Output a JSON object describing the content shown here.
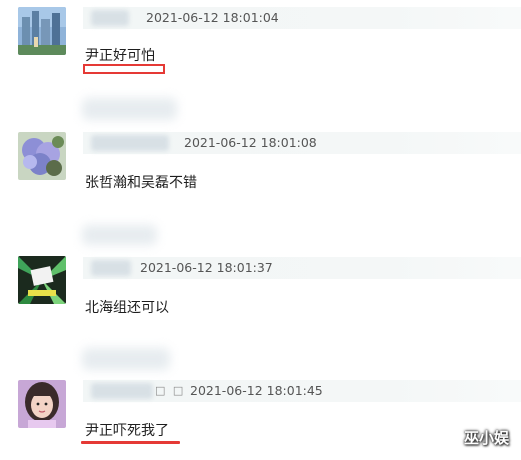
{
  "comments": [
    {
      "avatar": "anime-city-avatar-icon",
      "timestamp": "2021-06-12 18:01:04",
      "text": "尹正好可怕",
      "highlight": "box"
    },
    {
      "avatar": "hydrangea-flower-avatar-icon",
      "timestamp": "2021-06-12 18:01:08",
      "text": "张哲瀚和吴磊不错",
      "highlight": "none"
    },
    {
      "avatar": "meme-sticker-avatar-icon",
      "timestamp": "2021-06-12 18:01:37",
      "text": "北海组还可以",
      "highlight": "none"
    },
    {
      "avatar": "girl-portrait-avatar-icon",
      "timestamp": "2021-06-12 18:01:45",
      "text": "尹正吓死我了",
      "highlight": "underline",
      "name_suffix": "□ □"
    }
  ],
  "watermark": "巫小娱",
  "colors": {
    "highlight_red": "#e53935",
    "meta_bg": "#f3f6f6",
    "timestamp_gray": "#555555"
  }
}
